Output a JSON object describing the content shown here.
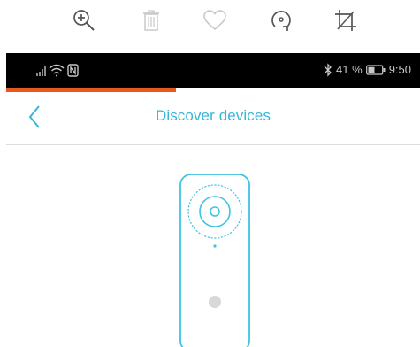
{
  "toolbar": {
    "icons": [
      "zoom-in-icon",
      "trash-icon",
      "heart-icon",
      "rotate-icon",
      "crop-icon"
    ]
  },
  "status_bar": {
    "icons_left": [
      "signal-icon",
      "wifi-icon",
      "nfc-icon"
    ],
    "icons_right": [
      "bluetooth-icon",
      "battery-icon"
    ],
    "battery_text": "41 %",
    "time": "9:50"
  },
  "progress": {
    "value_percent": 41,
    "color": "#e8581c"
  },
  "header": {
    "title": "Discover devices",
    "back_icon": "chevron-left-icon",
    "accent_color": "#3ab5d8"
  },
  "device": {
    "icon": "video-doorbell-icon"
  }
}
